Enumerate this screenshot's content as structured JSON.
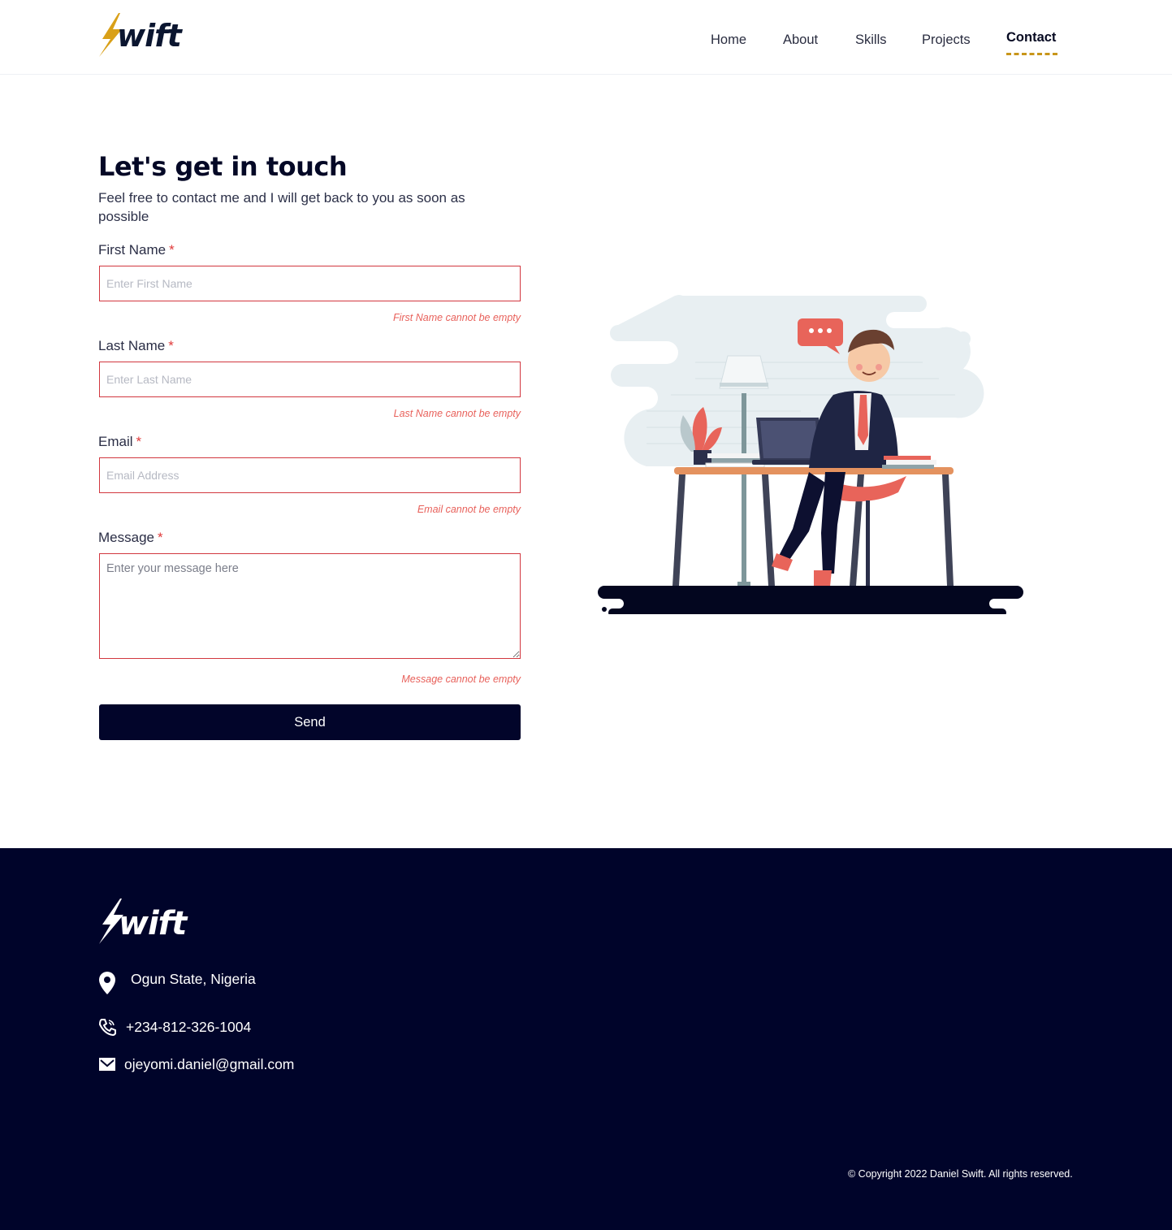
{
  "brand": {
    "logo_text": "wift",
    "accent": "#d9a018"
  },
  "nav": {
    "items": [
      {
        "label": "Home"
      },
      {
        "label": "About"
      },
      {
        "label": "Skills"
      },
      {
        "label": "Projects"
      },
      {
        "label": "Contact",
        "active": true
      }
    ]
  },
  "form": {
    "title": "Let's get in touch",
    "subtitle": "Feel free to contact me and I will get back to you as soon as possible",
    "required_mark": "*",
    "fields": {
      "first_name": {
        "label": "First Name",
        "placeholder": "Enter First Name",
        "value": "",
        "error": "First Name cannot be empty"
      },
      "last_name": {
        "label": "Last Name",
        "placeholder": "Enter Last Name",
        "value": "",
        "error": "Last Name cannot be empty"
      },
      "email": {
        "label": "Email",
        "placeholder": "Email Address",
        "value": "",
        "error": "Email cannot be empty"
      },
      "message": {
        "label": "Message",
        "placeholder": "Enter your message here",
        "value": "",
        "error": "Message cannot be empty"
      }
    },
    "send_label": "Send"
  },
  "illustration": {
    "icon": "person-at-desk-illustration"
  },
  "footer": {
    "logo_text": "wift",
    "location": "Ogun State, Nigeria",
    "phone": "+234-812-326-1004",
    "email": "ojeyomi.daniel@gmail.com",
    "copyright": "© Copyright 2022 Daniel Swift. All rights reserved.",
    "background": "#00042a"
  }
}
